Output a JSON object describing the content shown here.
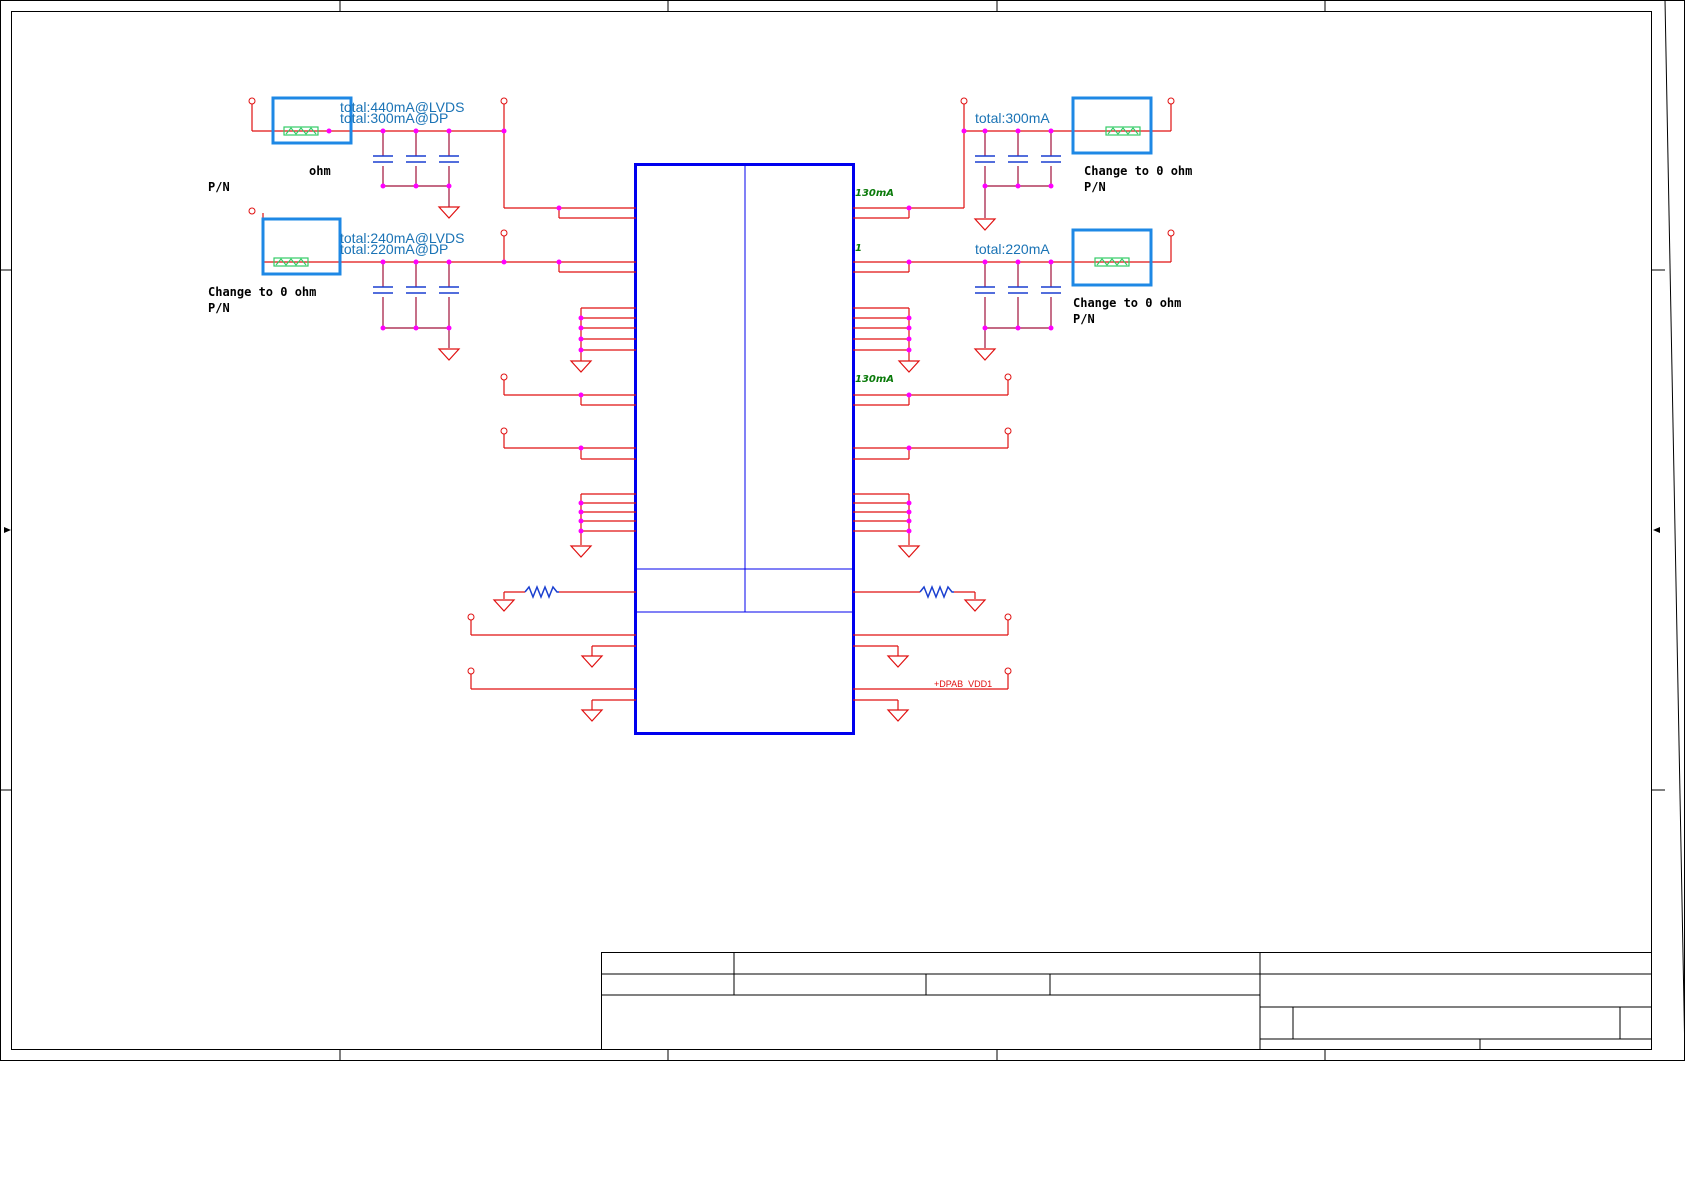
{
  "notes": {
    "tl_1": "total:440mA@LVDS",
    "tl_2": "total:300mA@DP",
    "ml_1": "total:240mA@LVDS",
    "ml_2": "total:220mA@DP",
    "tr_1": "total:300mA",
    "mr_1": "total:220mA"
  },
  "labels": {
    "tl_ohm": "ohm",
    "tl_pn": "P/N",
    "ml_change": "Change to 0 ohm",
    "ml_pn": "P/N",
    "tr_change": "Change to 0 ohm",
    "tr_pn": "P/N",
    "mr_change": "Change to 0 ohm",
    "mr_pn": "P/N"
  },
  "currents": {
    "r1": "130mA",
    "r2": "1",
    "r3": "130mA"
  },
  "nets": {
    "dpab_vdd1": "+DPAB_VDD1"
  },
  "colors": {
    "wire": "#e01010",
    "wire_dark": "#a0103a",
    "junction": "#ff00ff",
    "ic_body": "#0000ee",
    "highlight_box": "#1e88e5",
    "ferrite": "#33cc66",
    "capacitor": "#1a3fd0",
    "border": "#000000"
  }
}
